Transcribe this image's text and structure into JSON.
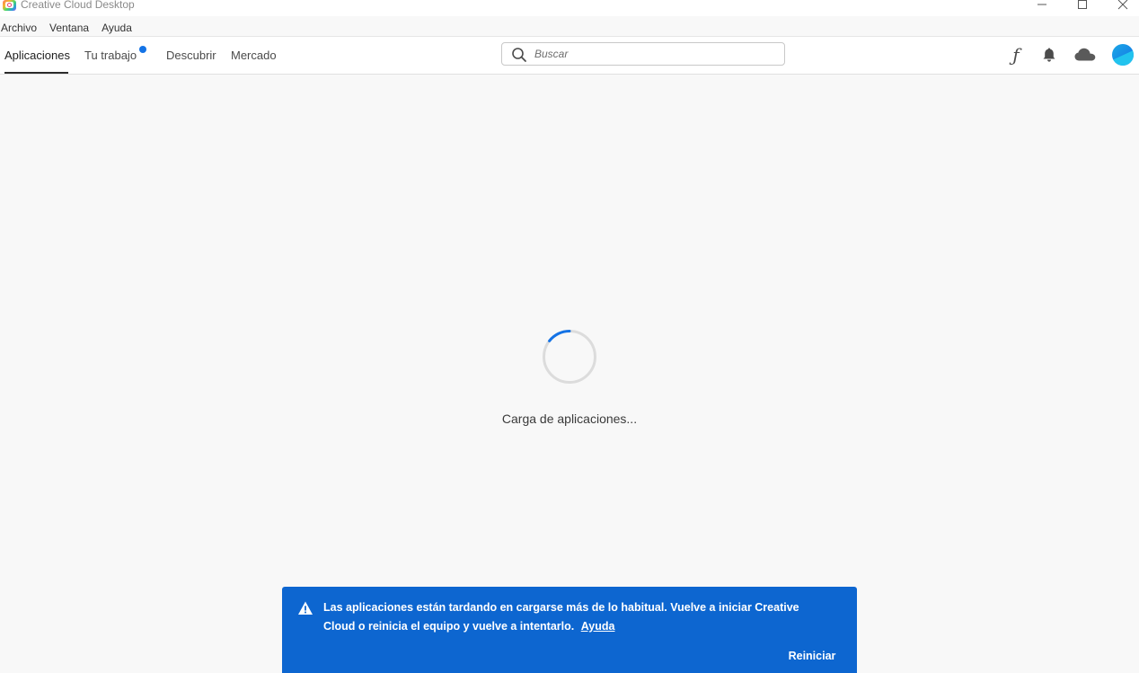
{
  "window": {
    "title": "Creative Cloud Desktop",
    "controls": [
      "minimize-icon",
      "maximize-icon",
      "close-icon"
    ]
  },
  "menu": {
    "items": [
      {
        "label": "Archivo"
      },
      {
        "label": "Ventana"
      },
      {
        "label": "Ayuda"
      }
    ]
  },
  "nav": {
    "tabs": [
      {
        "label": "Aplicaciones",
        "active": true
      },
      {
        "label": "Tu trabajo",
        "has_notification_dot": true
      },
      {
        "label": "Descubrir"
      },
      {
        "label": "Mercado"
      }
    ],
    "search": {
      "placeholder": "Buscar",
      "value": ""
    },
    "icons": [
      "fonts-icon",
      "bell-icon",
      "cloud-icon",
      "avatar"
    ]
  },
  "main": {
    "loading_text": "Carga de aplicaciones..."
  },
  "toast": {
    "message": "Las aplicaciones están tardando en cargarse más de lo habitual. Vuelve a iniciar Creative Cloud o reinicia el equipo y vuelve a intentarlo.",
    "link_label": "Ayuda",
    "action_label": "Reiniciar",
    "background": "#0d66d0"
  },
  "colors": {
    "accent": "#1473e6",
    "page_background": "#f8f8f8"
  }
}
